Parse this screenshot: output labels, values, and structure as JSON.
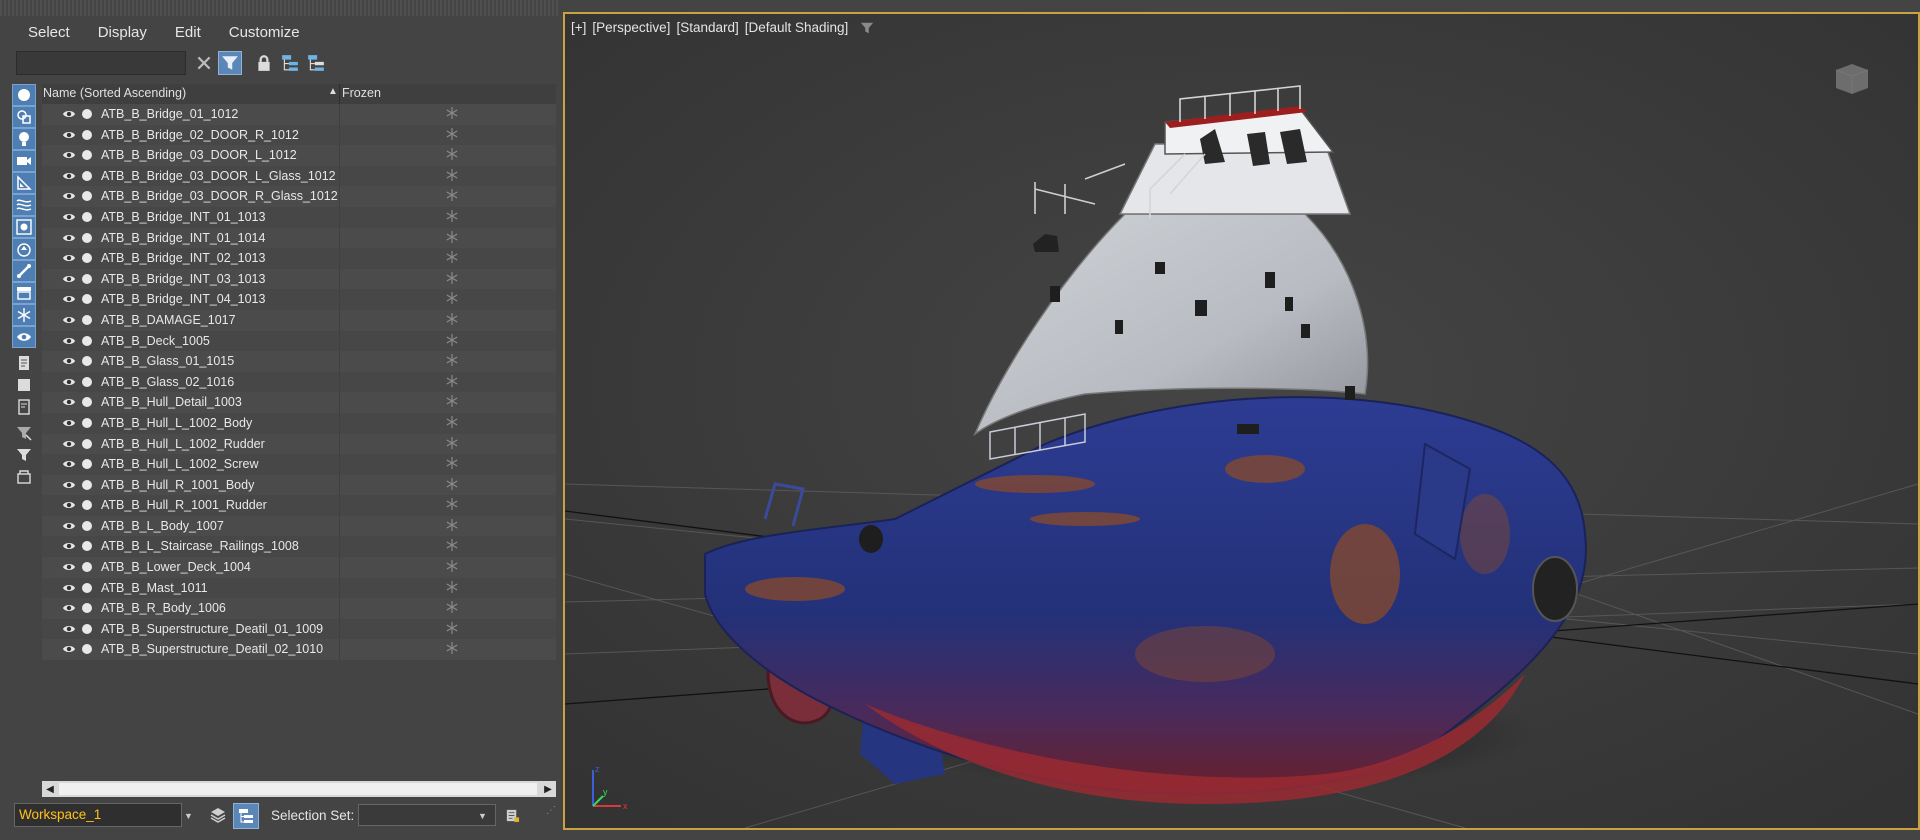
{
  "menu": [
    "Select",
    "Display",
    "Edit",
    "Customize"
  ],
  "search": {
    "value": "",
    "placeholder": ""
  },
  "columns": {
    "name": "Name (Sorted Ascending)",
    "frozen": "Frozen",
    "sort_arrow": "▲"
  },
  "objects": [
    "ATB_B_Bridge_01_1012",
    "ATB_B_Bridge_02_DOOR_R_1012",
    "ATB_B_Bridge_03_DOOR_L_1012",
    "ATB_B_Bridge_03_DOOR_L_Glass_1012",
    "ATB_B_Bridge_03_DOOR_R_Glass_1012",
    "ATB_B_Bridge_INT_01_1013",
    "ATB_B_Bridge_INT_01_1014",
    "ATB_B_Bridge_INT_02_1013",
    "ATB_B_Bridge_INT_03_1013",
    "ATB_B_Bridge_INT_04_1013",
    "ATB_B_DAMAGE_1017",
    "ATB_B_Deck_1005",
    "ATB_B_Glass_01_1015",
    "ATB_B_Glass_02_1016",
    "ATB_B_Hull_Detail_1003",
    "ATB_B_Hull_L_1002_Body",
    "ATB_B_Hull_L_1002_Rudder",
    "ATB_B_Hull_L_1002_Screw",
    "ATB_B_Hull_R_1001_Body",
    "ATB_B_Hull_R_1001_Rudder",
    "ATB_B_L_Body_1007",
    "ATB_B_L_Staircase_Railings_1008",
    "ATB_B_Lower_Deck_1004",
    "ATB_B_Mast_1011",
    "ATB_B_R_Body_1006",
    "ATB_B_Superstructure_Deatil_01_1009",
    "ATB_B_Superstructure_Deatil_02_1010"
  ],
  "left_icons": [
    "sphere-icon",
    "shapes-icon",
    "light-icon",
    "camera-icon",
    "helper-icon",
    "spacewarp-icon",
    "group-icon",
    "xref-icon",
    "bone-icon",
    "container-icon",
    "frozen-icon",
    "hidden-icon",
    "doc-icon",
    "square-icon",
    "doc2-icon",
    "filter-funnel-icon",
    "filter-icon",
    "box-icon"
  ],
  "bottom": {
    "workspace": "Workspace_1",
    "selection_set_label": "Selection Set:",
    "selection_set_value": ""
  },
  "viewport": {
    "labels": [
      "[+]",
      "[Perspective]",
      "[Standard]",
      "[Default Shading]"
    ],
    "viewcube": "viewcube",
    "axes": [
      "x",
      "y",
      "z"
    ]
  },
  "colors": {
    "accent": "#5a86b8",
    "viewport_border": "#c8a441",
    "workspace_text": "#ffc21a",
    "hull_blue": "#2a3d8f",
    "rust": "#8a4a2a"
  }
}
